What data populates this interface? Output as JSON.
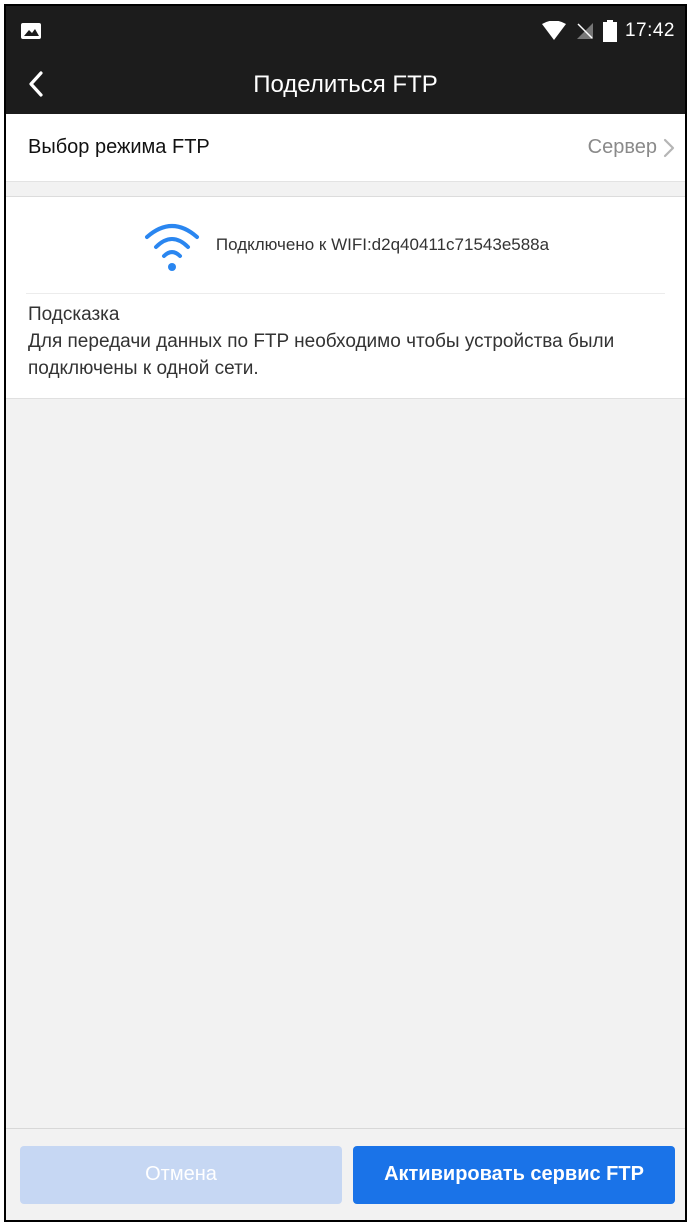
{
  "status_bar": {
    "time": "17:42",
    "icons": [
      "gallery-icon",
      "wifi-icon",
      "no-sim-icon",
      "battery-icon"
    ]
  },
  "header": {
    "title": "Поделиться FTP",
    "back_icon": "chevron-left-icon"
  },
  "mode": {
    "label": "Выбор режима FTP",
    "value": "Сервер"
  },
  "connection": {
    "text": "Подключено к WIFI:d2q40411c71543e588a",
    "icon": "wifi-icon"
  },
  "hint": {
    "title": "Подсказка",
    "text": "Для передачи данных по FTP необходимо чтобы устройства были подключены к одной сети."
  },
  "buttons": {
    "cancel": "Отмена",
    "activate": "Активировать сервис FTP"
  },
  "colors": {
    "bar": "#1c1c1c",
    "accent": "#1a73e8",
    "wifi": "#2a86f0",
    "disabled": "#c6d7f3"
  }
}
